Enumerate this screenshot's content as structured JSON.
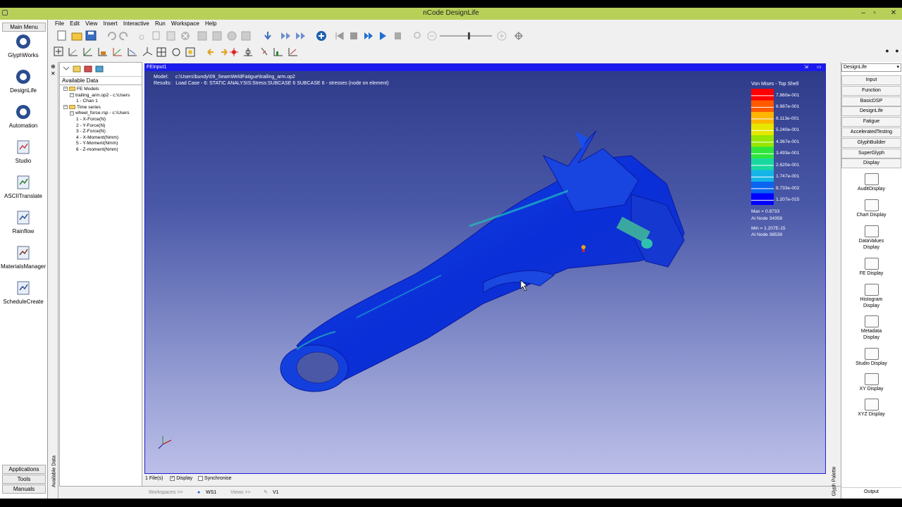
{
  "app": {
    "title": "nCode DesignLife"
  },
  "main_menu": {
    "header": "Main Menu",
    "items": [
      {
        "label": "GlyphWorks",
        "icon": "glyphworks-icon"
      },
      {
        "label": "DesignLife",
        "icon": "designlife-icon"
      },
      {
        "label": "Automation",
        "icon": "automation-icon"
      },
      {
        "label": "Studio",
        "icon": "studio-icon"
      },
      {
        "label": "ASCIITranslate",
        "icon": "ascii-translate-icon"
      },
      {
        "label": "Rainflow",
        "icon": "rainflow-icon"
      },
      {
        "label": "MaterialsManager",
        "icon": "materials-manager-icon"
      },
      {
        "label": "ScheduleCreate",
        "icon": "schedule-create-icon"
      }
    ],
    "footer": [
      "Applications",
      "Tools",
      "Manuals"
    ]
  },
  "menubar": [
    "File",
    "Edit",
    "View",
    "Insert",
    "Interactive",
    "Run",
    "Workspace",
    "Help"
  ],
  "data_panel": {
    "header": "Available Data",
    "side_label": "Available Data",
    "tree": [
      {
        "text": "FE Models",
        "level": 0,
        "toggle": "−",
        "folder": true
      },
      {
        "text": "trailing_arm.op2 - c:\\Users",
        "level": 1,
        "toggle": "−",
        "folder": false
      },
      {
        "text": "1 - Chan 1",
        "level": 2,
        "toggle": "",
        "folder": false
      },
      {
        "text": "Time series",
        "level": 0,
        "toggle": "−",
        "folder": true
      },
      {
        "text": "wheel_force.rsp - c:\\Users",
        "level": 1,
        "toggle": "−",
        "folder": false
      },
      {
        "text": "1 - X-Force(N)",
        "level": 2,
        "toggle": "",
        "folder": false
      },
      {
        "text": "2 - Y-Force(N)",
        "level": 2,
        "toggle": "",
        "folder": false
      },
      {
        "text": "3 - Z-Force(N)",
        "level": 2,
        "toggle": "",
        "folder": false
      },
      {
        "text": "4 - X-Moment(Nmm)",
        "level": 2,
        "toggle": "",
        "folder": false
      },
      {
        "text": "5 - Y-Moment(Nmm)",
        "level": 2,
        "toggle": "",
        "folder": false
      },
      {
        "text": "6 - Z-moment(Nmm)",
        "level": 2,
        "toggle": "",
        "folder": false
      }
    ]
  },
  "viewer": {
    "title": "FEInput1",
    "model_label": "Model:",
    "model_value": "c:\\Users\\bundy\\09_SeamWeldFatigue\\trailing_arm.op2",
    "results_label": "Results:",
    "results_value": "Load Case - 6: STATIC ANALYSIS:Stress:SUBCASE 6 SUBCASE 6 - stresses (node on element)",
    "legend_title": "Von Mises - Top Shell",
    "legend_values": [
      "7.860e-001",
      "6.987e-001",
      "6.113e-001",
      "5.240e-001",
      "4.367e-001",
      "3.493e-001",
      "2.620e-001",
      "1.747e-001",
      "8.733e-002",
      "1.207e-015"
    ],
    "legend_colors": [
      "#ff0000",
      "#ff5a00",
      "#ffb400",
      "#e6e600",
      "#96e600",
      "#2ee63c",
      "#18d8a0",
      "#14b4e6",
      "#0a64f0",
      "#0000ff"
    ],
    "max_text": "Max = 0.8733",
    "max_node": "At Node 34358",
    "min_text": "Min = 1.207E-15",
    "min_node": "At Node 36539",
    "status_files": "1 File(s)",
    "status_display": "Display",
    "status_sync": "Synchronise"
  },
  "bottom_tabs": {
    "workspaces": "Workspaces >>",
    "ws1": "WS1",
    "views": "Views >>",
    "v1": "V1"
  },
  "palette": {
    "dropdown": "DesignLife",
    "side_label": "Glyph Palette",
    "categories": [
      "Input",
      "Function",
      "BasicDSP",
      "DesignLife",
      "Fatigue",
      "AcceleratedTesting",
      "GlyphBuilder",
      "SuperGlyph",
      "Display"
    ],
    "glyphs": [
      {
        "label": "AuditDisplay",
        "label2": "",
        "icon": "audit-display-icon"
      },
      {
        "label": "Chart Display",
        "label2": "",
        "icon": "chart-display-icon"
      },
      {
        "label": "DataValues",
        "label2": "Display",
        "icon": "data-values-display-icon"
      },
      {
        "label": "FE Display",
        "label2": "",
        "icon": "fe-display-icon"
      },
      {
        "label": "Histogram",
        "label2": "Display",
        "icon": "histogram-display-icon"
      },
      {
        "label": "Metadata",
        "label2": "Display",
        "icon": "metadata-display-icon"
      },
      {
        "label": "Studio Display",
        "label2": "",
        "icon": "studio-display-icon"
      },
      {
        "label": "XY Display",
        "label2": "",
        "icon": "xy-display-icon"
      },
      {
        "label": "XYZ Display",
        "label2": "",
        "icon": "xyz-display-icon"
      }
    ],
    "footer": "Output"
  }
}
